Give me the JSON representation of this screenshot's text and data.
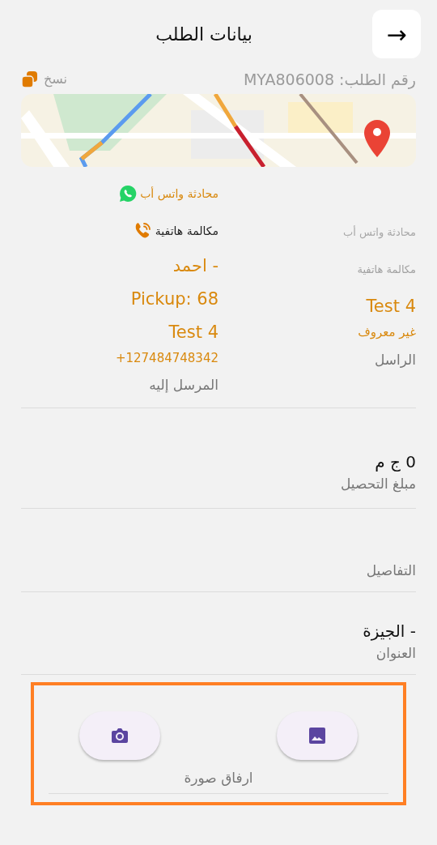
{
  "header": {
    "title": "بيانات الطلب",
    "back_glyph": "→"
  },
  "order": {
    "number": "رقم الطلب: MYA806008",
    "copy_label": "نسخ"
  },
  "sender": {
    "actions": [
      {
        "kind": "whatsapp",
        "label": "محادثة واتس أب",
        "disabled": true
      },
      {
        "kind": "call",
        "label": "مكالمة هاتفية",
        "disabled": true
      }
    ],
    "lines": [
      "Test 4"
    ],
    "detail": "غير معروف",
    "label": "الراسل"
  },
  "recipient": {
    "actions": [
      {
        "kind": "whatsapp",
        "label": "محادثة واتس أب",
        "disabled": false
      },
      {
        "kind": "call",
        "label": "مكالمة هاتفية",
        "disabled": false
      }
    ],
    "lines": [
      "- احمد",
      "Pickup: 68",
      "Test 4"
    ],
    "detail": "+127484748342",
    "label": "المرسل إليه"
  },
  "fields": [
    {
      "value": "0 ج م",
      "label": "مبلغ التحصيل"
    },
    {
      "label": "التفاصيل"
    },
    {
      "value": "- الجيزة",
      "label": "العنوان"
    }
  ],
  "attach": {
    "highlighted": true,
    "label": "ارفاق صورة",
    "buttons": [
      {
        "kind": "gallery"
      },
      {
        "kind": "camera"
      }
    ]
  }
}
